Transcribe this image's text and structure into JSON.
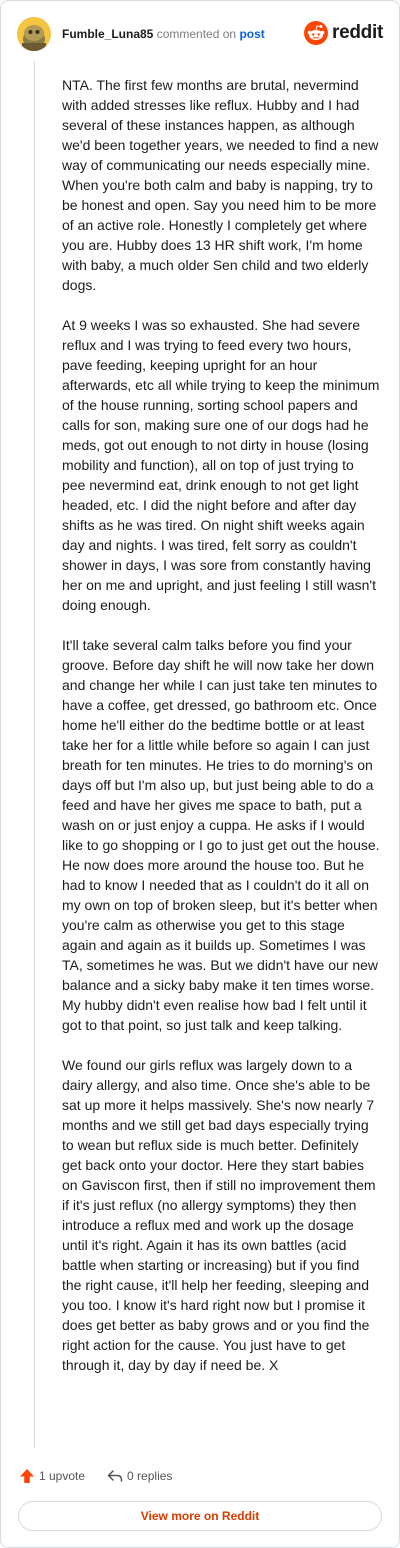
{
  "comment": {
    "username": "Fumble_Luna85",
    "action_text": "commented on",
    "post_link": "post",
    "paragraphs": [
      "NTA. The first few months are brutal, nevermind with added stresses like reflux. Hubby and I had several of these instances happen, as although we'd been together years, we needed to find a new way of communicating our needs especially mine. When you're both calm and baby is napping, try to be honest and open. Say you need him to be more of an active role. Honestly I completely get where you are. Hubby does 13 HR shift work, I'm home with baby, a much older Sen child and two elderly dogs.",
      "At 9 weeks I was so exhausted. She had severe reflux and I was trying to feed every two hours, pave feeding, keeping upright for an hour afterwards, etc all while trying to keep the minimum of the house running, sorting school papers and calls for son, making sure one of our dogs had he meds, got out enough to not dirty in house (losing mobility and function), all on top of just trying to pee nevermind eat, drink enough to not get light headed, etc. I did the night before and after day shifts as he was tired. On night shift weeks again day and nights. I was tired, felt sorry as couldn't shower in days, I was sore from constantly having her on me and upright, and just feeling I still wasn't doing enough.",
      "It'll take several calm talks before you find your groove. Before day shift he will now take her down and change her while I can just take ten minutes to have a coffee, get dressed, go bathroom etc. Once home he'll either do the bedtime bottle or at least take her for a little while before so again I can just breath for ten minutes. He tries to do morning's on days off but I'm also up, but just being able to do a feed and have her gives me space to bath, put a wash on or just enjoy a cuppa. He asks if I would like to go shopping or I go to just get out the house. He now does more around the house too. But he had to know I needed that as I couldn't do it all on my own on top of broken sleep, but it's better when you're calm as otherwise you get to this stage again and again as it builds up. Sometimes I was TA, sometimes he was. But we didn't have our new balance and a sicky baby make it ten times worse. My hubby didn't even realise how bad I felt until it got to that point, so just talk and keep talking.",
      "We found our girls reflux was largely down to a dairy allergy, and also time. Once she's able to be sat up more it helps massively. She's now nearly 7 months and we still get bad days especially trying to wean but reflux side is much better. Definitely get back onto your doctor. Here they start babies on Gaviscon first, then if still no improvement them if it's just reflux (no allergy symptoms) they then introduce a reflux med and work up the dosage until it's right. Again it has its own battles (acid battle when starting or increasing) but if you find the right cause, it'll help her feeding, sleeping and you too. I know it's hard right now but I promise it does get better as baby grows and or you find the right action for the cause. You just have to get through it, day by day if need be. X"
    ],
    "upvotes": "1 upvote",
    "replies": "0 replies"
  },
  "brand": {
    "wordmark": "reddit",
    "icon": "reddit-snoo-icon",
    "color": "#ff4500"
  },
  "footer": {
    "view_more": "View more on Reddit"
  },
  "colors": {
    "accent_orange": "#d93a00",
    "link_blue": "#0b5fd9",
    "avatar": "#f4c542"
  }
}
